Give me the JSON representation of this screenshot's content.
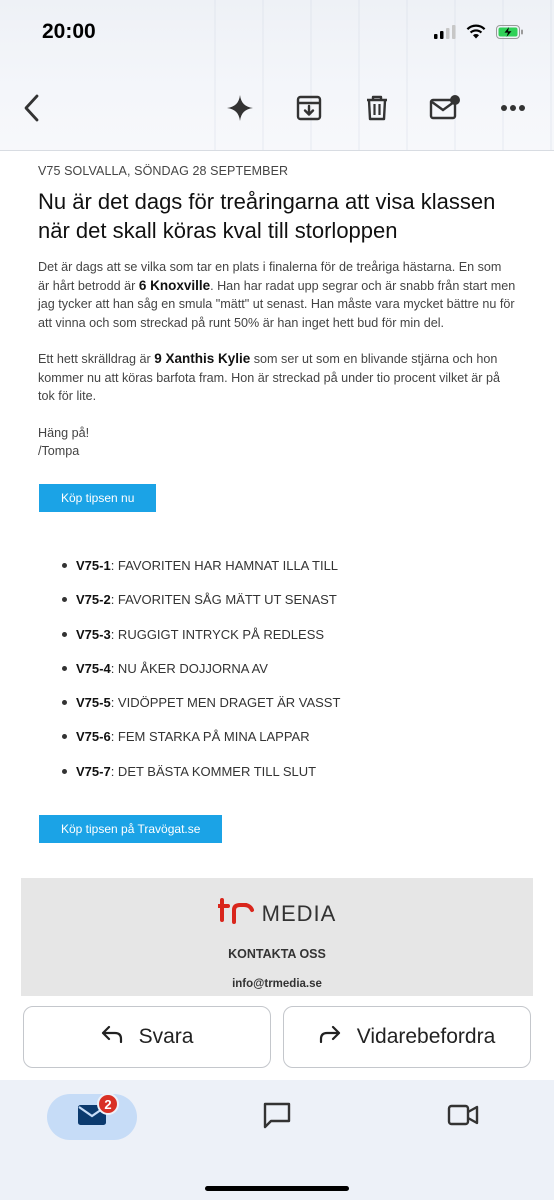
{
  "status_bar": {
    "time": "20:00",
    "icons": [
      "signal-icon",
      "wifi-icon",
      "battery-charging-icon"
    ]
  },
  "toolbar": {
    "icons": [
      "back-arrow-icon",
      "sparkle-icon",
      "archive-icon",
      "trash-icon",
      "mark-unread-icon",
      "more-icon"
    ]
  },
  "email": {
    "kicker": "V75 SOLVALLA, SÖNDAG 28 SEPTEMBER",
    "headline": "Nu är det dags för treåringarna att visa klassen när det skall köras kval till storloppen",
    "p1_a": "Det är dags att se vilka som tar en plats i finalerna för de treåriga hästarna. En som är hårt betrodd är ",
    "p1_bold": "6 Knoxville",
    "p1_b": ". Han har radat upp segrar och är snabb från start men jag tycker att han såg en smula \"mätt\" ut senast. Han måste vara mycket bättre nu för att vinna och som streckad på runt 50% är han inget hett bud för min del.",
    "p2_a": "Ett hett skrälldrag är ",
    "p2_bold": "9 Xanthis Kylie",
    "p2_b": " som ser ut som en blivande stjärna och hon kommer nu att köras barfota fram. Hon är streckad på under tio procent vilket är på tok för lite.",
    "sign_1": "Häng på!",
    "sign_2": "/Tompa",
    "button_1": "Köp tipsen nu",
    "list": [
      {
        "code": "V75-1",
        "text": ": FAVORITEN HAR HAMNAT ILLA TILL"
      },
      {
        "code": "V75-2",
        "text": ": FAVORITEN SÅG MÄTT UT SENAST"
      },
      {
        "code": "V75-3",
        "text": ": RUGGIGT INTRYCK PÅ REDLESS"
      },
      {
        "code": "V75-4",
        "text": ": NU ÅKER DOJJORNA AV"
      },
      {
        "code": "V75-5",
        "text": ": VIDÖPPET MEN DRAGET ÄR VASST"
      },
      {
        "code": "V75-6",
        "text": ": FEM STARKA PÅ MINA LAPPAR"
      },
      {
        "code": "V75-7",
        "text": ": DET BÄSTA KOMMER TILL SLUT"
      }
    ],
    "button_2": "Köp tipsen på Travögat.se",
    "footer": {
      "logo_mark": "tr",
      "logo_text": "MEDIA",
      "contact": "KONTAKTA OSS",
      "email": "info@trmedia.se"
    }
  },
  "actions": {
    "reply": "Svara",
    "forward": "Vidarebefordra"
  },
  "bottom_nav": {
    "mail_badge": "2",
    "icons": [
      "mail-icon",
      "chat-icon",
      "video-icon"
    ]
  },
  "colors": {
    "button_blue": "#1ba3e6",
    "logo_red": "#d9261c",
    "badge_red": "#d93025",
    "nav_pill": "#c6dcf7"
  }
}
